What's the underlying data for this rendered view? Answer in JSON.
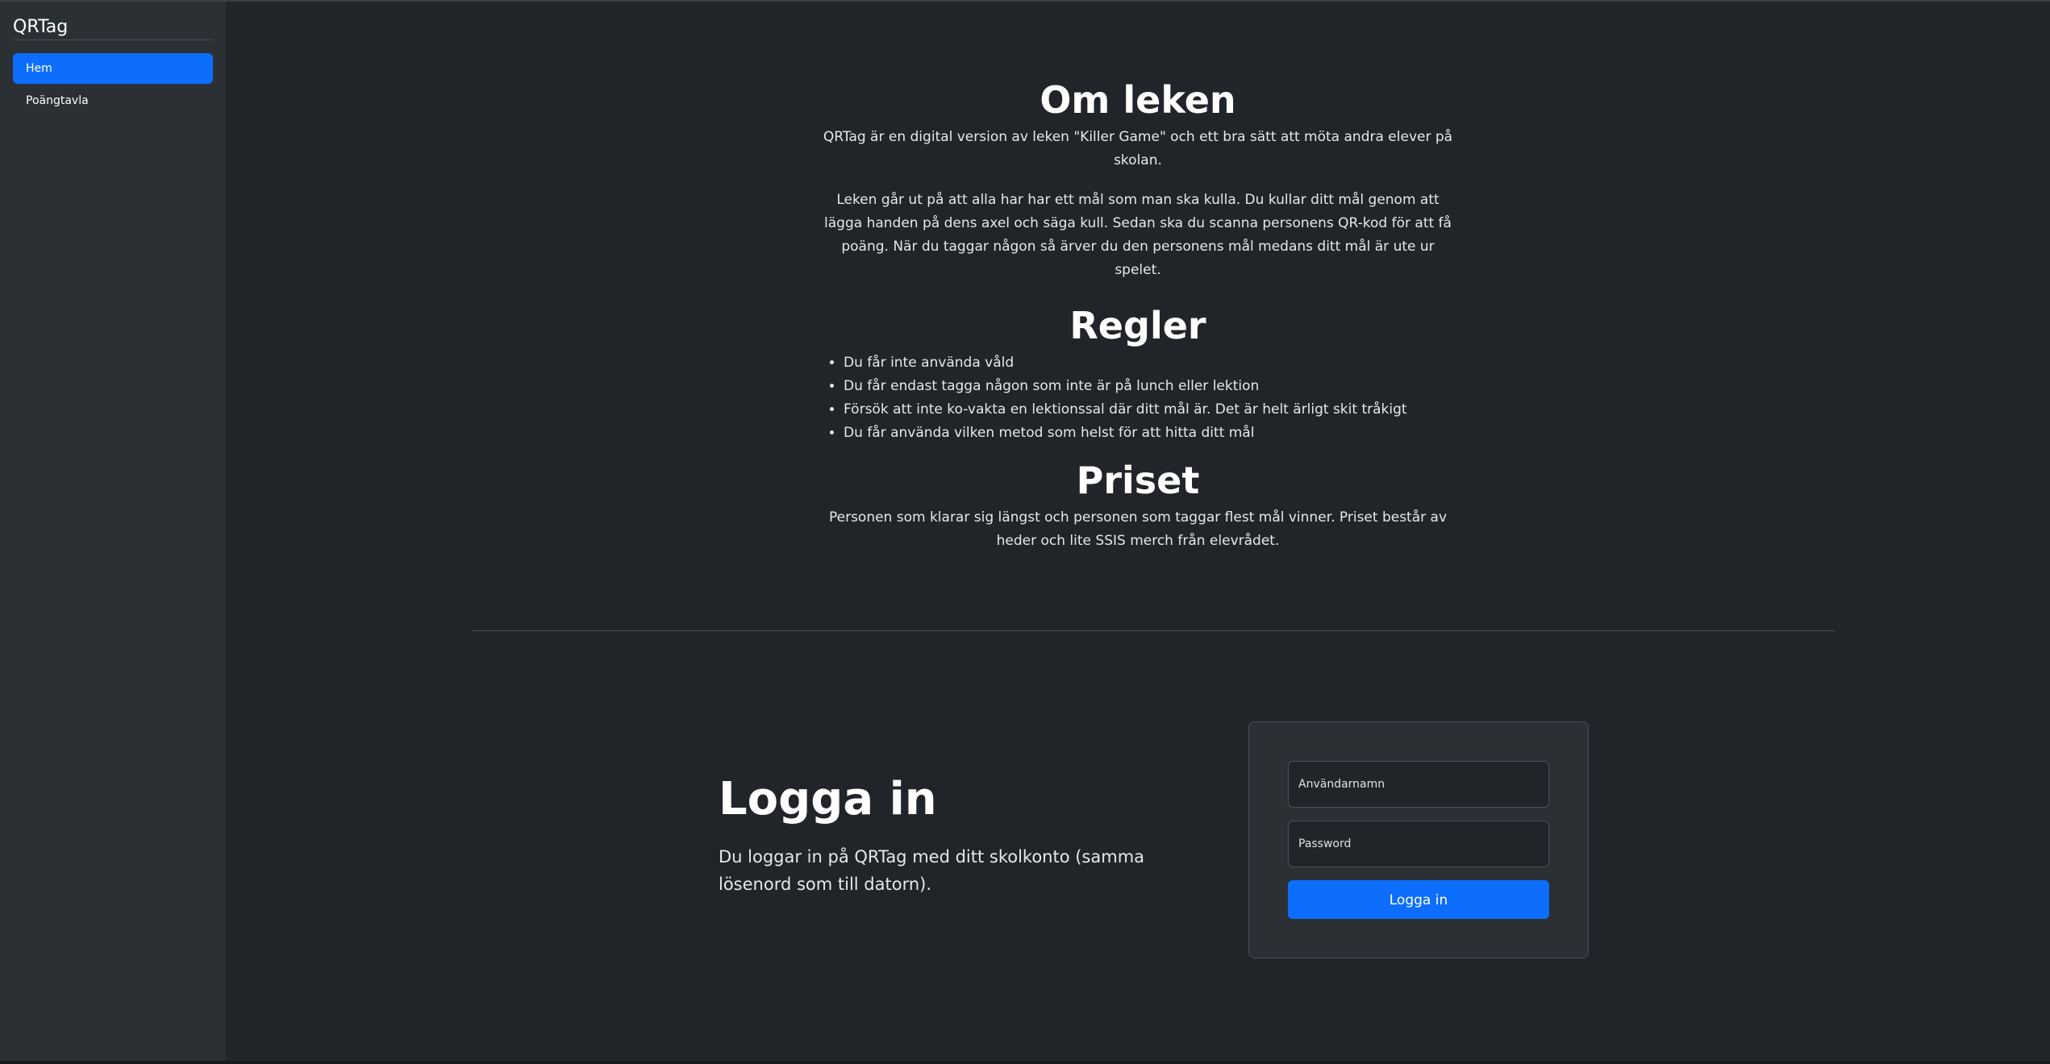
{
  "app": {
    "brand": "QRTag"
  },
  "sidebar": {
    "items": [
      {
        "label": "Hem",
        "active": true
      },
      {
        "label": "Poängtavla",
        "active": false
      }
    ]
  },
  "about": {
    "title": "Om leken",
    "intro": "QRTag är en digital version av leken \"Killer Game\" och ett bra sätt att möta andra elever på skolan.",
    "description": "Leken går ut på att alla har har ett mål som man ska kulla. Du kullar ditt mål genom att lägga handen på dens axel och säga kull. Sedan ska du scanna personens QR-kod för att få poäng. När du taggar någon så ärver du den personens mål medans ditt mål är ute ur spelet."
  },
  "rules": {
    "title": "Regler",
    "items": [
      "Du får inte använda våld",
      "Du får endast tagga någon som inte är på lunch eller lektion",
      "Försök att inte ko-vakta en lektionssal där ditt mål är. Det är helt ärligt skit tråkigt",
      "Du får använda vilken metod som helst för att hitta ditt mål"
    ]
  },
  "prize": {
    "title": "Priset",
    "text": "Personen som klarar sig längst och personen som taggar flest mål vinner. Priset består av heder och lite SSIS merch från elevrådet."
  },
  "login": {
    "title": "Logga in",
    "subtitle": "Du loggar in på QRTag med ditt skolkonto (samma lösenord som till datorn).",
    "username_placeholder": "Användarnamn",
    "password_placeholder": "Password",
    "button_label": "Logga in"
  },
  "colors": {
    "accent": "#0d6efd",
    "background": "#212529",
    "sidebar": "#2b3035"
  }
}
